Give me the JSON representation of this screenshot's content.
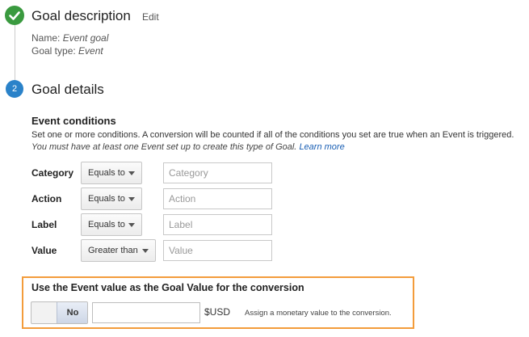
{
  "step1": {
    "icon": "check-icon",
    "title": "Goal description",
    "edit_label": "Edit",
    "name_label": "Name:",
    "name_value": "Event goal",
    "type_label": "Goal type:",
    "type_value": "Event"
  },
  "step2": {
    "number": "2",
    "title": "Goal details"
  },
  "event_conditions": {
    "title": "Event conditions",
    "description": "Set one or more conditions. A conversion will be counted if all of the conditions you set are true when an Event is triggered.",
    "requirement": "You must have at least one Event set up to create this type of Goal.",
    "learn_more": "Learn more",
    "rows": [
      {
        "label": "Category",
        "operator": "Equals to",
        "placeholder": "Category"
      },
      {
        "label": "Action",
        "operator": "Equals to",
        "placeholder": "Action"
      },
      {
        "label": "Label",
        "operator": "Equals to",
        "placeholder": "Label"
      },
      {
        "label": "Value",
        "operator": "Greater than",
        "placeholder": "Value"
      }
    ]
  },
  "goal_value": {
    "title": "Use the Event value as the Goal Value for the conversion",
    "toggle_label": "No",
    "currency": "$USD",
    "hint": "Assign a monetary value to the conversion.",
    "input_value": ""
  },
  "colors": {
    "check_green": "#3a9a3f",
    "step_blue": "#2a82c9",
    "highlight_orange": "#f39c3b",
    "link_blue": "#1a5fb4"
  }
}
